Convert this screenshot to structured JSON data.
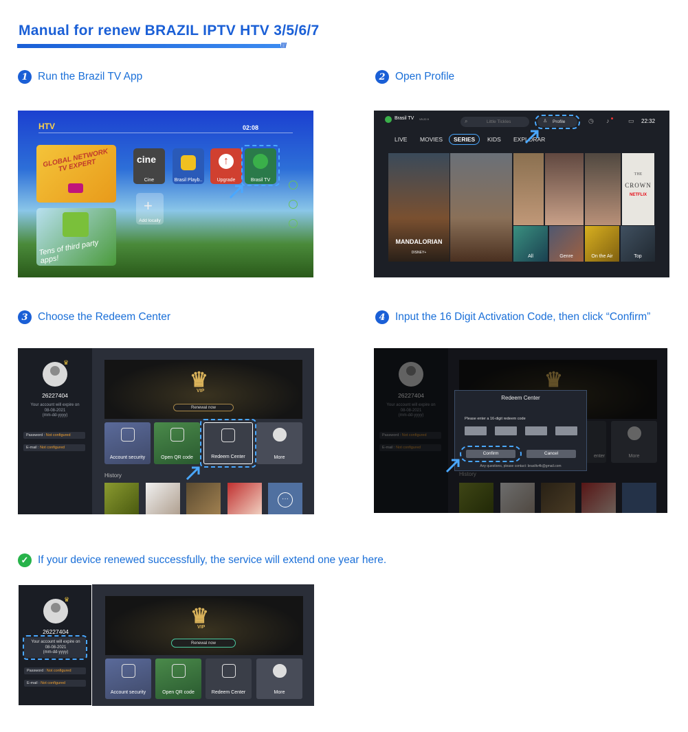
{
  "header": {
    "title": "Manual for renew BRAZIL IPTV HTV 3/5/6/7"
  },
  "steps": [
    {
      "num": "1",
      "label": "Run the Brazil TV App"
    },
    {
      "num": "2",
      "label": "Open Profile"
    },
    {
      "num": "3",
      "label": "Choose the Redeem Center"
    },
    {
      "num": "4",
      "label": "Input the 16 Digit Activation Code, then click “Confirm”"
    }
  ],
  "success": {
    "label": "If your device renewed successfully, the service will extend one year here."
  },
  "launcher": {
    "logo": "HTV",
    "clock": "02:08",
    "promo1": "GLOBAL NETWORK TV EXPERT",
    "promo2": "Tens of third party apps!",
    "apps": [
      "Cine",
      "Brasil Playb..",
      "Upgrade",
      "Brasil TV"
    ],
    "add_locally": "Add locally",
    "cine_logo": "cine"
  },
  "profile_screen": {
    "app_name": "Brasil TV",
    "version": "V5.22.9",
    "search_placeholder": "Little Tickles",
    "profile_label": "Profile",
    "time": "22:32",
    "tabs": [
      "LIVE",
      "MOVIES",
      "SERIES",
      "KIDS",
      "EXPLORAR"
    ],
    "active_tab": "SERIES",
    "poster_mandalorian": "MANDALORIAN",
    "poster_disney": "DISNEY+",
    "poster_crown_the": "THE",
    "poster_crown": "CROWN",
    "poster_netflix": "NETFLIX",
    "categories": [
      "All",
      "Genre",
      "On the Air",
      "Top"
    ]
  },
  "account": {
    "user_id": "26227404",
    "expire_line1": "Your account will expire on",
    "expire_date": "08-08-2021",
    "expire_format": "(mm-dd-yyyy)",
    "password_label": "Password :",
    "password_value": "Not configured",
    "email_label": "E-mail :",
    "email_value": "Not configured",
    "renewal": "Renewal now",
    "vip": "VIP",
    "cards": [
      "Account security",
      "Open QR code",
      "Redeem Center",
      "More"
    ],
    "history": "History"
  },
  "redeem_modal": {
    "title": "Redeem Center",
    "prompt": "Please enter a 16-digit redeem code",
    "confirm": "Confirm",
    "cancel": "Cancel",
    "contact": "Any questions, please contact: brasiltv4k@gmail.com",
    "behind_card": "enter"
  },
  "colors": {
    "accent": "#1a5fd6",
    "step_text": "#1a6fd8",
    "success": "#27b34a",
    "highlight_dash": "#4aa8ff"
  }
}
